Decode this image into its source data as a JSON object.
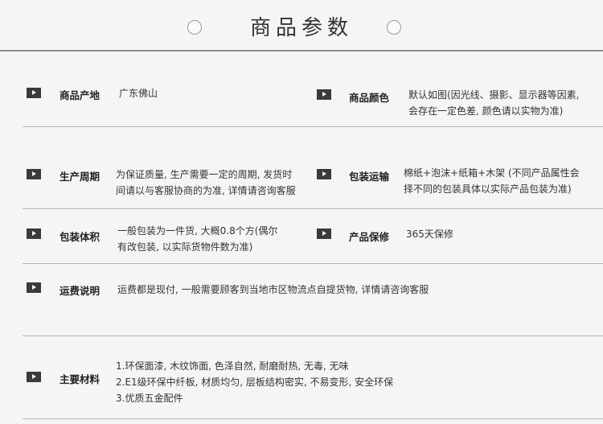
{
  "title": "商品参数",
  "rows": [
    {
      "label": "商品产地",
      "value": [
        "广东佛山"
      ]
    },
    {
      "label": "商品颜色",
      "value": [
        "默认如图(因光线、摄影、显示器等因素,",
        "会存在一定色差, 颜色请以实物为准)"
      ]
    },
    {
      "label": "生产周期",
      "value": [
        "为保证质量, 生产需要一定的周期, 发货时",
        "间请以与客服协商的为准, 详情请咨询客服"
      ]
    },
    {
      "label": "包装运输",
      "value": [
        "棉纸+泡沫+纸箱+木架 (不同产品属性会",
        "择不同的包装具体以实际产品包装为准)"
      ]
    },
    {
      "label": "包装体积",
      "value": [
        "一般包装为一件货, 大概0.8个方(偶尔",
        "有改包装, 以实际货物件数为准)"
      ]
    },
    {
      "label": "产品保修",
      "value": [
        "365天保修"
      ]
    },
    {
      "label": "运费说明",
      "value": [
        "运费都是现付, 一般需要顾客到当地市区物流点自提货物, 详情请咨询客服"
      ]
    },
    {
      "label": "主要材料",
      "value": [
        "1.环保面漆, 木纹饰面, 色泽自然, 耐磨耐热, 无毒, 无味",
        "2.E1级环保中纤板, 材质均匀, 层板结构密实, 不易变形, 安全环保",
        "3.优质五金配件"
      ]
    }
  ]
}
